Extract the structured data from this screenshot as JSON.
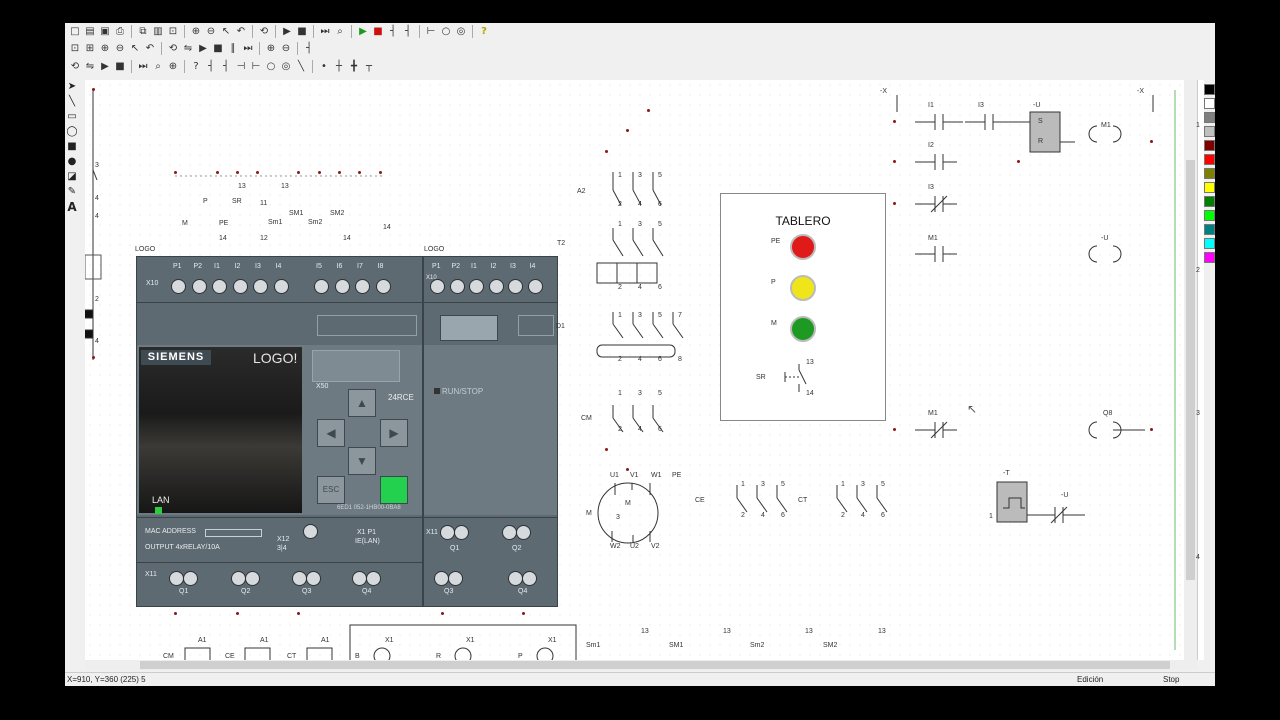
{
  "toolbar_rows": [
    [
      "new",
      "open",
      "save",
      "print",
      "|",
      "cut",
      "copy",
      "paste",
      "|",
      "zoom-page",
      "zoom-area",
      "zoom-in",
      "zoom-out",
      "|",
      "select",
      "|",
      "undo",
      "redo",
      "|",
      "rotate",
      "mirror",
      "|",
      "run",
      "stop",
      "pause",
      "step",
      "|",
      "zoom",
      "zoom-plus",
      "zoom-minus",
      "|",
      "help"
    ],
    [
      "contact-no",
      "contact-nc",
      "pushbutton",
      "switch",
      "coil",
      "coil-set",
      "|",
      "link",
      "link2",
      "node",
      "cross",
      "junction",
      "t",
      "|",
      "label",
      "label2",
      "|",
      "minus"
    ],
    [
      "relay",
      "timer",
      "counter",
      "motor",
      "|",
      "arrow",
      "loop",
      "circle",
      "|",
      "block1",
      "block2",
      "block3",
      "block4",
      "block5",
      "block6",
      "block7",
      "block8",
      "|",
      "up",
      "down",
      "line",
      "dash"
    ]
  ],
  "status": {
    "coords": "X=910, Y=360 (225) 5",
    "mode": "Edición",
    "run": "Stop"
  },
  "plc_left": {
    "label": "LOGO",
    "top_terminal_group": "X10",
    "top_terminals": [
      "P1",
      "P2",
      "I1",
      "I2",
      "I3",
      "I4",
      "I5",
      "I6",
      "I7",
      "I8"
    ],
    "brand": "SIEMENS",
    "model": "LOGO!",
    "lan": "LAN",
    "x50": "X50",
    "variant": "24RCE",
    "part_no": "6ED1 052-1HB00-0BA8",
    "esc": "ESC",
    "mac": "MAC ADDRESS",
    "output_desc": "OUTPUT 4xRELAY/10A",
    "x12": "X12",
    "x12_sub": "3|4",
    "x1p1": "X1 P1",
    "ielan": "IE(LAN)",
    "bottom_group": "X11",
    "outputs": [
      "Q1",
      "Q2",
      "Q3",
      "Q4"
    ]
  },
  "plc_right": {
    "label": "LOGO",
    "top_terminal_group": "X10",
    "top_terminals": [
      "P1",
      "P2",
      "I1",
      "I2",
      "I3",
      "I4"
    ],
    "run_stop": "RUN/STOP",
    "bottom_group": "X11",
    "outputs": [
      "Q1",
      "Q2",
      "Q3",
      "Q4"
    ]
  },
  "tablero": {
    "title": "TABLERO",
    "lamps": [
      {
        "label": "PE",
        "color": "#e01919"
      },
      {
        "label": "P",
        "color": "#efe61a"
      },
      {
        "label": "M",
        "color": "#1e9a22"
      }
    ],
    "switch_label": "SR",
    "switch_n1": "13",
    "switch_n2": "14"
  },
  "power": {
    "a2": "A2",
    "t2": "T2",
    "d1": "D1",
    "cm": "CM",
    "ce": "CE",
    "ct": "CT",
    "motor": "M",
    "motor_sym": "3",
    "motor_terms": [
      "U1",
      "V1",
      "W1",
      "PE",
      "W2",
      "U2",
      "V2"
    ],
    "n_top": [
      "1",
      "3",
      "5"
    ],
    "n_bot": [
      "2",
      "4",
      "6"
    ],
    "n7": "7",
    "n8": "8"
  },
  "ladder": {
    "x_left": "-X",
    "x_right": "-X",
    "i1": "I1",
    "i3": "I3",
    "u": "-U",
    "s": "S",
    "r": "R",
    "m1": "M1",
    "i2": "I2",
    "i3b": "I3",
    "m1b": "M1",
    "u2": "-U",
    "m1c": "M1",
    "q8": "Q8",
    "t": "-T",
    "u3": "-U",
    "one": "1"
  },
  "inputs_diag": {
    "p": "P",
    "sr": "SR",
    "m": "M",
    "pe": "PE",
    "sm1": "SM1",
    "sm2": "SM2",
    "sm1b": "Sm1",
    "sm2b": "Sm2",
    "n13": "13",
    "n14": "14",
    "n11": "11",
    "n12": "12"
  },
  "bottom": {
    "cm": "CM",
    "ce": "CE",
    "ct": "CT",
    "a1": "A1",
    "b": "B",
    "r": "R",
    "p": "P",
    "x1": "X1",
    "sm1": "Sm1",
    "sm1b": "SM1",
    "sm2": "Sm2",
    "sm2b": "SM2",
    "n13": "13"
  },
  "ruler_nums": [
    "1",
    "2",
    "3",
    "4"
  ],
  "left_ruler_nums": [
    "3",
    "4",
    "4",
    "2",
    "4"
  ],
  "palette": [
    "#000000",
    "#ffffff",
    "#808080",
    "#c0c0c0",
    "#800000",
    "#ff0000",
    "#808000",
    "#ffff00",
    "#008000",
    "#00ff00",
    "#008080",
    "#00ffff",
    "#ff00ff"
  ]
}
